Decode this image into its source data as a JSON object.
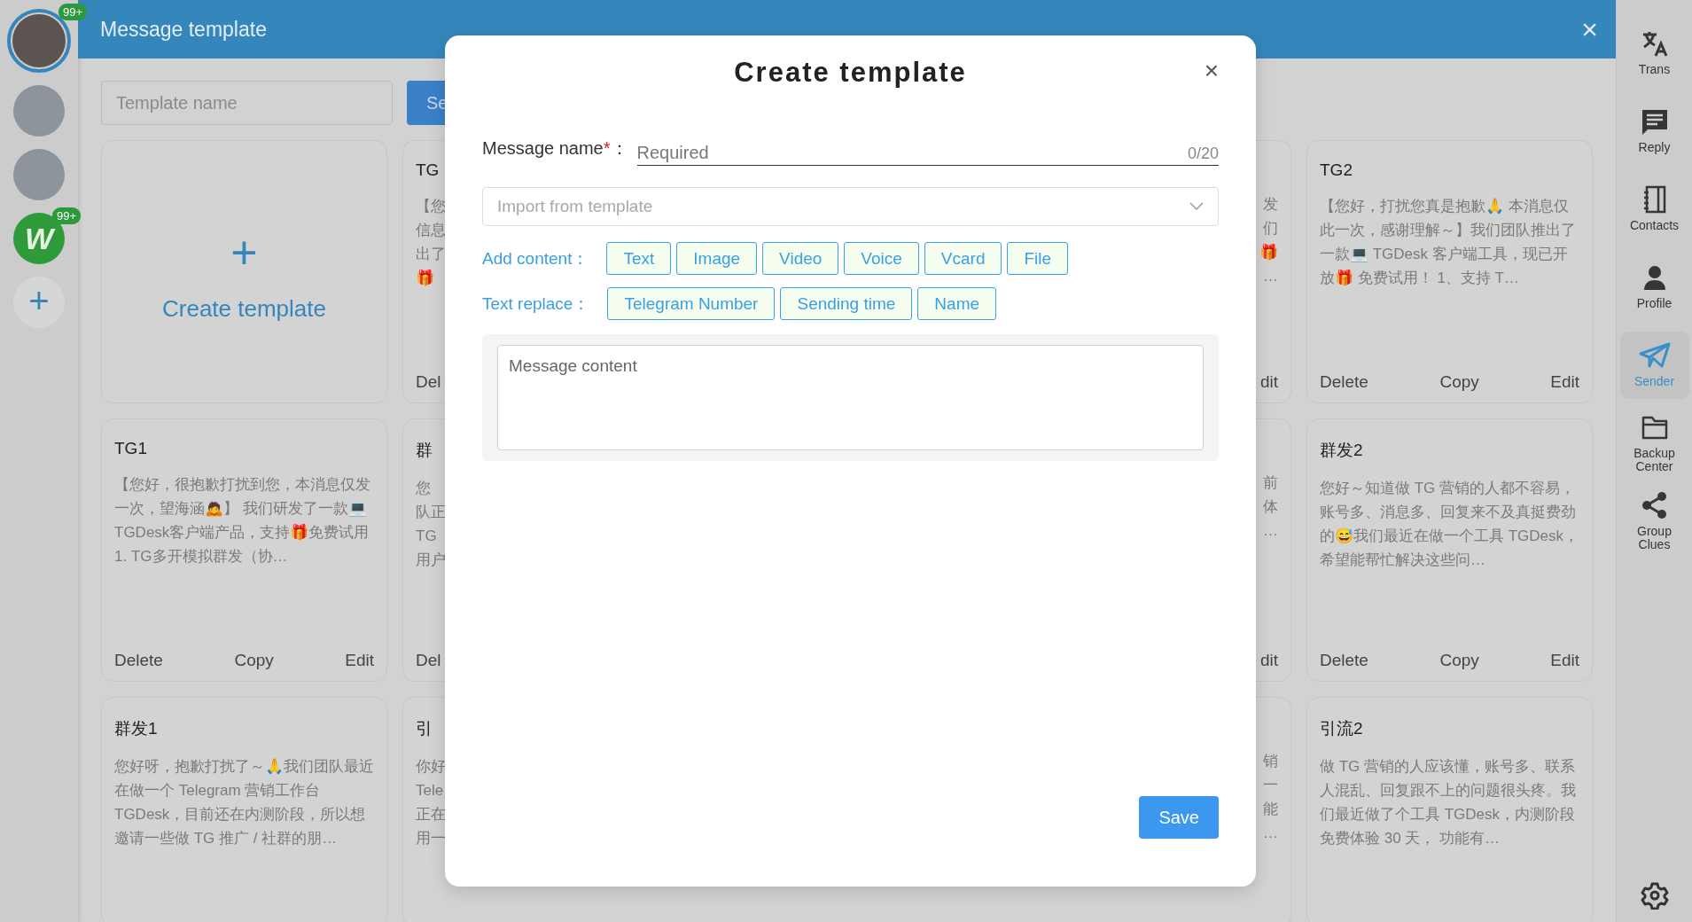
{
  "accounts": [
    {
      "kind": "photo",
      "selected": true,
      "badge": "99+"
    },
    {
      "kind": "photo",
      "selected": false
    },
    {
      "kind": "photo",
      "selected": false
    },
    {
      "kind": "logo",
      "selected": false,
      "label": "W",
      "badge": "99+"
    }
  ],
  "add_account": "+",
  "header": {
    "title": "Message template",
    "close": "×"
  },
  "search": {
    "placeholder": "Template name",
    "button": "Se"
  },
  "create_card": {
    "plus": "+",
    "label": "Create template"
  },
  "cards_left": [
    {
      "title": "TG1",
      "preview": "【您好，很抱歉打扰到您，本消息仅发一次，望海涵🙇】 我们研发了一款💻TGDesk客户端产品，支持🎁免费试用 1. TG多开模拟群发（协…",
      "actions": [
        "Delete",
        "Copy",
        "Edit"
      ]
    },
    {
      "title": "群发1",
      "preview": "您好呀，抱歉打扰了～🙏我们团队最近在做一个 Telegram 营销工作台 TGDesk，目前还在内测阶段，所以想邀请一些做 TG 推广 / 社群的朋…"
    }
  ],
  "partial_left": [
    {
      "title": "TG",
      "lines": [
        "【您",
        "信息",
        "出了",
        "🎁"
      ],
      "action": "Del"
    },
    {
      "title": "群",
      "lines": [
        "您",
        "队正",
        "TG",
        "用户"
      ],
      "action": "Del"
    },
    {
      "title": "引",
      "lines": [
        "你好",
        "Tele",
        "正在",
        "用一"
      ]
    }
  ],
  "partial_right": [
    {
      "lines": [
        "发",
        "们",
        "🎁",
        "…"
      ],
      "action": "dit"
    },
    {
      "lines": [
        "前",
        "体",
        "…"
      ],
      "action": "dit"
    },
    {
      "lines": [
        "销",
        "一",
        "能",
        "…"
      ]
    }
  ],
  "cards_right": [
    {
      "title": "TG2",
      "preview": "【您好，打扰您真是抱歉🙏 本消息仅此一次，感谢理解～】我们团队推出了一款💻 TGDesk 客户端工具，现已开放🎁 免费试用！ 1、支持 T…",
      "actions": [
        "Delete",
        "Copy",
        "Edit"
      ]
    },
    {
      "title": "群发2",
      "preview": "您好～知道做 TG 营销的人都不容易，账号多、消息多、回复来不及真挺费劲的😅我们最近在做一个工具 TGDesk，希望能帮忙解决这些问…",
      "actions": [
        "Delete",
        "Copy",
        "Edit"
      ]
    },
    {
      "title": "引流2",
      "preview": "做 TG 营销的人应该懂，账号多、联系人混乱、回复跟不上的问题很头疼。我们最近做了个工具 TGDesk，内测阶段免费体验 30 天， 功能有…"
    }
  ],
  "rail": [
    {
      "kind": "translate",
      "label": "Trans",
      "selected": false
    },
    {
      "kind": "reply",
      "label": "Reply",
      "selected": false
    },
    {
      "kind": "contacts",
      "label": "Contacts",
      "selected": false
    },
    {
      "kind": "profile",
      "label": "Profile",
      "selected": false
    },
    {
      "kind": "sender",
      "label": "Sender",
      "selected": true
    },
    {
      "kind": "backup",
      "label": "Backup Center",
      "selected": false
    },
    {
      "kind": "share",
      "label": "Group Clues",
      "selected": false
    }
  ],
  "modal": {
    "title": "Create template",
    "close": "×",
    "name_field": {
      "label": "Message name",
      "required_mark": "*",
      "colon": "：",
      "placeholder": "Required",
      "counter": "0/20"
    },
    "import_select": {
      "placeholder": "Import from template"
    },
    "add_content": {
      "label": "Add content：",
      "buttons": [
        "Text",
        "Image",
        "Video",
        "Voice",
        "Vcard",
        "File"
      ]
    },
    "text_replace": {
      "label": "Text replace：",
      "buttons": [
        "Telegram Number",
        "Sending time",
        "Name"
      ]
    },
    "content": {
      "placeholder": "Message content"
    },
    "save": "Save"
  }
}
